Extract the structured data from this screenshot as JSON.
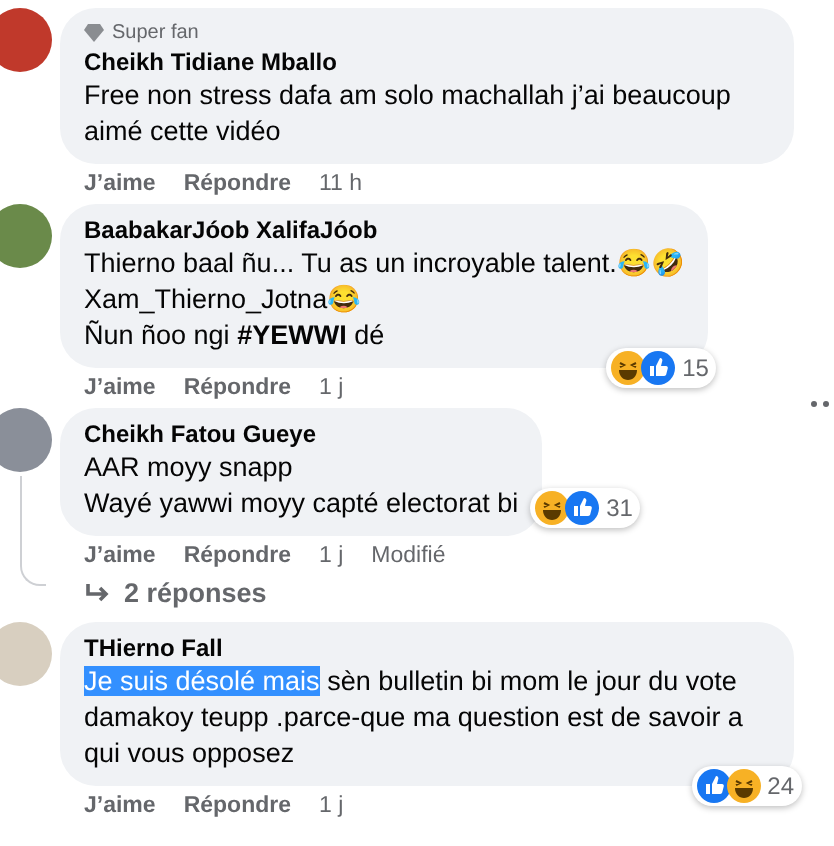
{
  "comments": [
    {
      "badge": "Super fan",
      "author": "Cheikh Tidiane Mballo",
      "lines": [
        [
          {
            "text": "Free non stress dafa am solo machallah j’ai beaucoup aimé cette vidéo"
          }
        ]
      ],
      "actions": [
        "J’aime",
        "Répondre",
        "11 h"
      ]
    },
    {
      "author": "BaabakarJóob XalifaJóob",
      "lines": [
        [
          {
            "text": "Thierno baal ñu... Tu as un incroyable talent.😂🤣"
          }
        ],
        [
          {
            "text": "Xam_Thierno_Jotna😂"
          }
        ],
        [
          {
            "text": "Ñun ñoo ngi **#YEWWI** dé"
          }
        ]
      ],
      "actions": [
        "J’aime",
        "Répondre",
        "1 j"
      ],
      "reactions": {
        "icons": [
          {
            "kind": "haha"
          },
          {
            "kind": "like"
          }
        ],
        "count": "15"
      }
    },
    {
      "author": "Cheikh Fatou Gueye",
      "lines": [
        [
          {
            "text": "AAR moyy snapp"
          }
        ],
        [
          {
            "text": "Wayé yawwi moyy capté electorat bi"
          }
        ]
      ],
      "actions": [
        "J’aime",
        "Répondre",
        "1 j",
        "Modifié"
      ],
      "reactions": {
        "icons": [
          {
            "kind": "haha"
          },
          {
            "kind": "like"
          }
        ],
        "count": "31"
      },
      "replies": "2 réponses"
    },
    {
      "author": "THierno Fall",
      "lines": [
        [
          {
            "text": "Je suis désolé mais",
            "selected": true
          },
          {
            "text": " sèn bulletin bi mom le jour du vote damakoy teupp .parce-que ma question est de savoir a qui vous opposez",
            "selected": false
          }
        ]
      ],
      "actions": [
        "J’aime",
        "Répondre",
        "1 j"
      ],
      "reactions": {
        "icons": [
          {
            "kind": "like"
          },
          {
            "kind": "haha"
          }
        ],
        "count": "24"
      }
    }
  ]
}
